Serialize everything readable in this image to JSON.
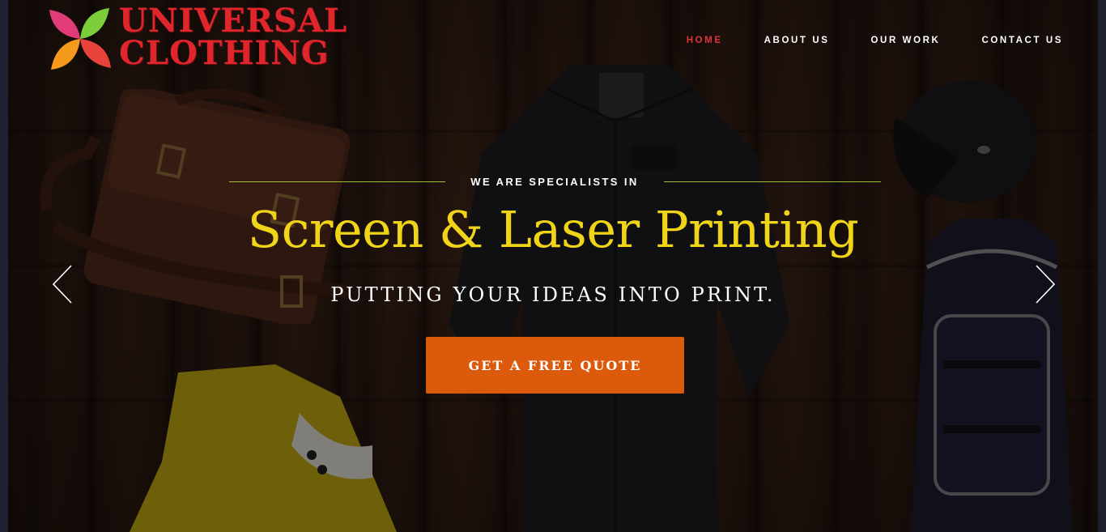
{
  "brand": {
    "line1": "UNIVERSAL",
    "line2": "CLOTHING",
    "color": "#e0262d",
    "mark_colors": [
      "#e23b7a",
      "#f59a1c",
      "#7ccf3a",
      "#e8433b"
    ]
  },
  "nav": {
    "items": [
      {
        "label": "HOME",
        "active": true
      },
      {
        "label": "ABOUT US",
        "active": false
      },
      {
        "label": "OUR WORK",
        "active": false
      },
      {
        "label": "CONTACT US",
        "active": false
      }
    ],
    "active_color": "#e0343a"
  },
  "hero": {
    "kicker": "WE ARE SPECIALISTS IN",
    "headline": "Screen & Laser Printing",
    "subline": "PUTTING YOUR IDEAS INTO PRINT.",
    "cta_label": "GET A FREE QUOTE",
    "headline_color": "#f0d418",
    "cta_color": "#dc5a0b",
    "prev_icon": "chevron-left-icon",
    "next_icon": "chevron-right-icon"
  }
}
